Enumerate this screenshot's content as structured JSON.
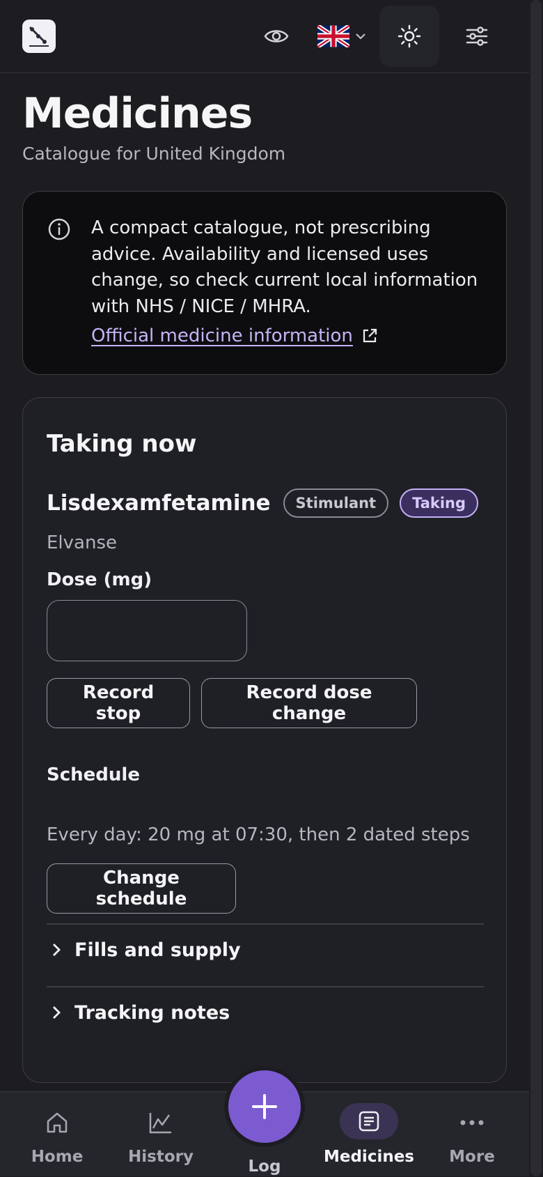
{
  "header": {
    "language": "English (United Kingdom)",
    "colors": {
      "accent": "#7c5bd1",
      "background": "#1c1c21"
    }
  },
  "page": {
    "title": "Medicines",
    "subtitle": "Catalogue for United Kingdom"
  },
  "notice": {
    "text": "A compact catalogue, not prescribing advice. Availability and licensed uses change, so check current local information with NHS / NICE / MHRA.",
    "link_label": "Official medicine information"
  },
  "taking_now": {
    "title": "Taking now",
    "medicine": {
      "name": "Lisdexamfetamine",
      "class_chip": "Stimulant",
      "status_chip": "Taking",
      "brand": "Elvanse"
    },
    "dose": {
      "label": "Dose (mg)",
      "value": "",
      "placeholder": ""
    },
    "actions": {
      "record_stop": "Record stop",
      "record_dose_change": "Record dose change"
    },
    "schedule": {
      "label": "Schedule",
      "summary": "Every day: 20 mg at 07:30, then 2 dated steps",
      "change_button": "Change schedule"
    },
    "sections": [
      {
        "label": "Fills and supply"
      },
      {
        "label": "Tracking notes"
      }
    ]
  },
  "bottom_nav": {
    "items": [
      {
        "label": "Home",
        "icon": "home-icon"
      },
      {
        "label": "History",
        "icon": "chart-line-icon"
      },
      {
        "label": "Log",
        "icon": "plus-icon"
      },
      {
        "label": "Medicines",
        "icon": "document-icon",
        "active": true
      },
      {
        "label": "More",
        "icon": "more-dots-icon"
      }
    ]
  }
}
